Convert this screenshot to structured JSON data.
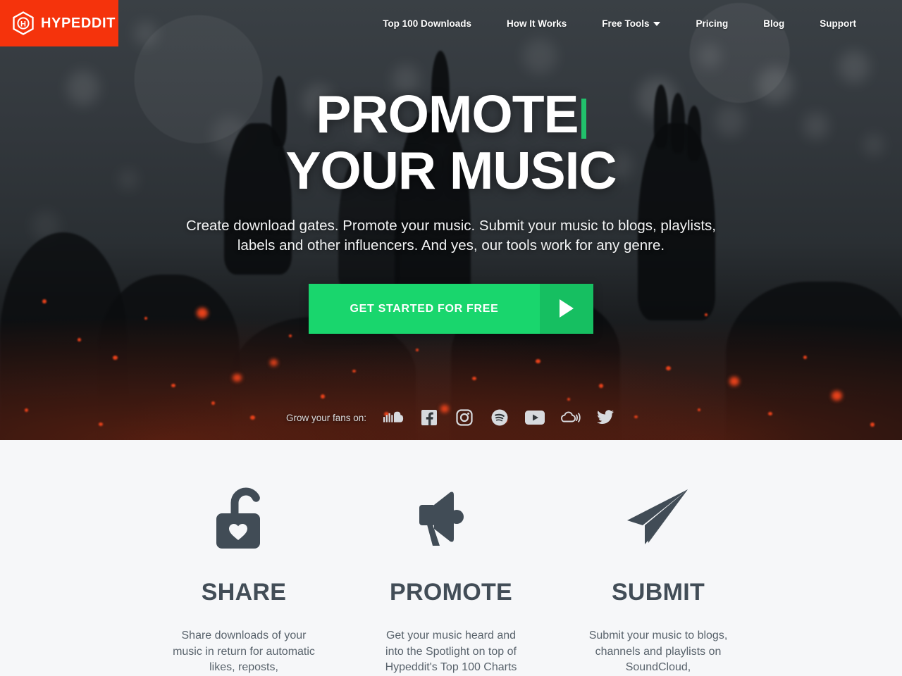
{
  "header": {
    "logo": {
      "text": "HYPEDDIT",
      "icon": "hexagon-h-icon",
      "bg_color": "#f5330c"
    },
    "nav": [
      {
        "label": "Top 100 Downloads",
        "name": "nav-top-100-downloads",
        "caret": false
      },
      {
        "label": "How It Works",
        "name": "nav-how-it-works",
        "caret": false
      },
      {
        "label": "Free Tools",
        "name": "nav-free-tools",
        "caret": true
      },
      {
        "label": "Pricing",
        "name": "nav-pricing",
        "caret": false
      },
      {
        "label": "Blog",
        "name": "nav-blog",
        "caret": false
      },
      {
        "label": "Support",
        "name": "nav-support",
        "caret": false
      }
    ]
  },
  "hero": {
    "headline_line1": "PROMOTE",
    "headline_line2": "YOUR MUSIC",
    "cursor_color": "#21c16b",
    "subtitle": "Create download gates. Promote your music. Submit your music to blogs, playlists, labels and other influencers. And yes, our tools work for any genre.",
    "cta_label": "GET STARTED FOR FREE",
    "cta_color": "#19d66d",
    "cta_arrow_color": "#16bf61",
    "social_label": "Grow your fans on:",
    "social_icons": [
      {
        "name": "soundcloud-icon"
      },
      {
        "name": "facebook-icon"
      },
      {
        "name": "instagram-icon"
      },
      {
        "name": "spotify-icon"
      },
      {
        "name": "youtube-icon"
      },
      {
        "name": "mixcloud-icon"
      },
      {
        "name": "twitter-icon"
      }
    ]
  },
  "features": [
    {
      "icon": "unlock-heart-icon",
      "title": "SHARE",
      "desc": "Share downloads of your music in return for automatic likes, reposts,"
    },
    {
      "icon": "megaphone-icon",
      "title": "PROMOTE",
      "desc": "Get your music heard and into the Spotlight on top of Hypeddit's Top 100 Charts"
    },
    {
      "icon": "paper-plane-icon",
      "title": "SUBMIT",
      "desc": "Submit your music to blogs, channels and playlists on SoundCloud,"
    }
  ],
  "colors": {
    "brand_red": "#f5330c",
    "accent_green": "#19d66d",
    "icon_slate": "#414c56",
    "section_bg": "#f6f7f9"
  }
}
